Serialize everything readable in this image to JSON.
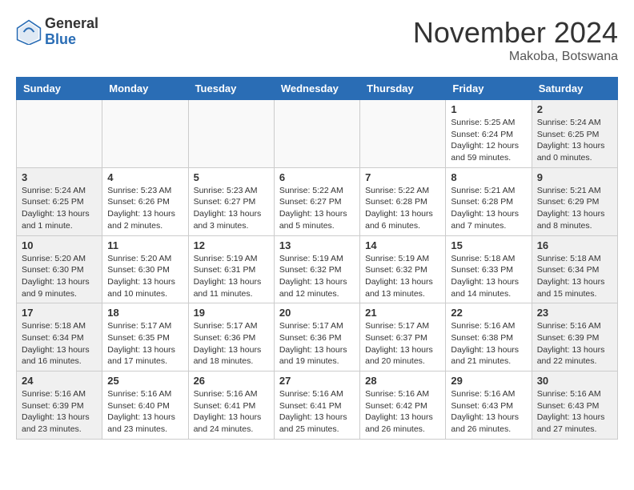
{
  "header": {
    "logo_general": "General",
    "logo_blue": "Blue",
    "month_year": "November 2024",
    "location": "Makoba, Botswana"
  },
  "days_of_week": [
    "Sunday",
    "Monday",
    "Tuesday",
    "Wednesday",
    "Thursday",
    "Friday",
    "Saturday"
  ],
  "weeks": [
    [
      {
        "day": "",
        "info": ""
      },
      {
        "day": "",
        "info": ""
      },
      {
        "day": "",
        "info": ""
      },
      {
        "day": "",
        "info": ""
      },
      {
        "day": "",
        "info": ""
      },
      {
        "day": "1",
        "info": "Sunrise: 5:25 AM\nSunset: 6:24 PM\nDaylight: 12 hours and 59 minutes."
      },
      {
        "day": "2",
        "info": "Sunrise: 5:24 AM\nSunset: 6:25 PM\nDaylight: 13 hours and 0 minutes."
      }
    ],
    [
      {
        "day": "3",
        "info": "Sunrise: 5:24 AM\nSunset: 6:25 PM\nDaylight: 13 hours and 1 minute."
      },
      {
        "day": "4",
        "info": "Sunrise: 5:23 AM\nSunset: 6:26 PM\nDaylight: 13 hours and 2 minutes."
      },
      {
        "day": "5",
        "info": "Sunrise: 5:23 AM\nSunset: 6:27 PM\nDaylight: 13 hours and 3 minutes."
      },
      {
        "day": "6",
        "info": "Sunrise: 5:22 AM\nSunset: 6:27 PM\nDaylight: 13 hours and 5 minutes."
      },
      {
        "day": "7",
        "info": "Sunrise: 5:22 AM\nSunset: 6:28 PM\nDaylight: 13 hours and 6 minutes."
      },
      {
        "day": "8",
        "info": "Sunrise: 5:21 AM\nSunset: 6:28 PM\nDaylight: 13 hours and 7 minutes."
      },
      {
        "day": "9",
        "info": "Sunrise: 5:21 AM\nSunset: 6:29 PM\nDaylight: 13 hours and 8 minutes."
      }
    ],
    [
      {
        "day": "10",
        "info": "Sunrise: 5:20 AM\nSunset: 6:30 PM\nDaylight: 13 hours and 9 minutes."
      },
      {
        "day": "11",
        "info": "Sunrise: 5:20 AM\nSunset: 6:30 PM\nDaylight: 13 hours and 10 minutes."
      },
      {
        "day": "12",
        "info": "Sunrise: 5:19 AM\nSunset: 6:31 PM\nDaylight: 13 hours and 11 minutes."
      },
      {
        "day": "13",
        "info": "Sunrise: 5:19 AM\nSunset: 6:32 PM\nDaylight: 13 hours and 12 minutes."
      },
      {
        "day": "14",
        "info": "Sunrise: 5:19 AM\nSunset: 6:32 PM\nDaylight: 13 hours and 13 minutes."
      },
      {
        "day": "15",
        "info": "Sunrise: 5:18 AM\nSunset: 6:33 PM\nDaylight: 13 hours and 14 minutes."
      },
      {
        "day": "16",
        "info": "Sunrise: 5:18 AM\nSunset: 6:34 PM\nDaylight: 13 hours and 15 minutes."
      }
    ],
    [
      {
        "day": "17",
        "info": "Sunrise: 5:18 AM\nSunset: 6:34 PM\nDaylight: 13 hours and 16 minutes."
      },
      {
        "day": "18",
        "info": "Sunrise: 5:17 AM\nSunset: 6:35 PM\nDaylight: 13 hours and 17 minutes."
      },
      {
        "day": "19",
        "info": "Sunrise: 5:17 AM\nSunset: 6:36 PM\nDaylight: 13 hours and 18 minutes."
      },
      {
        "day": "20",
        "info": "Sunrise: 5:17 AM\nSunset: 6:36 PM\nDaylight: 13 hours and 19 minutes."
      },
      {
        "day": "21",
        "info": "Sunrise: 5:17 AM\nSunset: 6:37 PM\nDaylight: 13 hours and 20 minutes."
      },
      {
        "day": "22",
        "info": "Sunrise: 5:16 AM\nSunset: 6:38 PM\nDaylight: 13 hours and 21 minutes."
      },
      {
        "day": "23",
        "info": "Sunrise: 5:16 AM\nSunset: 6:39 PM\nDaylight: 13 hours and 22 minutes."
      }
    ],
    [
      {
        "day": "24",
        "info": "Sunrise: 5:16 AM\nSunset: 6:39 PM\nDaylight: 13 hours and 23 minutes."
      },
      {
        "day": "25",
        "info": "Sunrise: 5:16 AM\nSunset: 6:40 PM\nDaylight: 13 hours and 23 minutes."
      },
      {
        "day": "26",
        "info": "Sunrise: 5:16 AM\nSunset: 6:41 PM\nDaylight: 13 hours and 24 minutes."
      },
      {
        "day": "27",
        "info": "Sunrise: 5:16 AM\nSunset: 6:41 PM\nDaylight: 13 hours and 25 minutes."
      },
      {
        "day": "28",
        "info": "Sunrise: 5:16 AM\nSunset: 6:42 PM\nDaylight: 13 hours and 26 minutes."
      },
      {
        "day": "29",
        "info": "Sunrise: 5:16 AM\nSunset: 6:43 PM\nDaylight: 13 hours and 26 minutes."
      },
      {
        "day": "30",
        "info": "Sunrise: 5:16 AM\nSunset: 6:43 PM\nDaylight: 13 hours and 27 minutes."
      }
    ]
  ]
}
